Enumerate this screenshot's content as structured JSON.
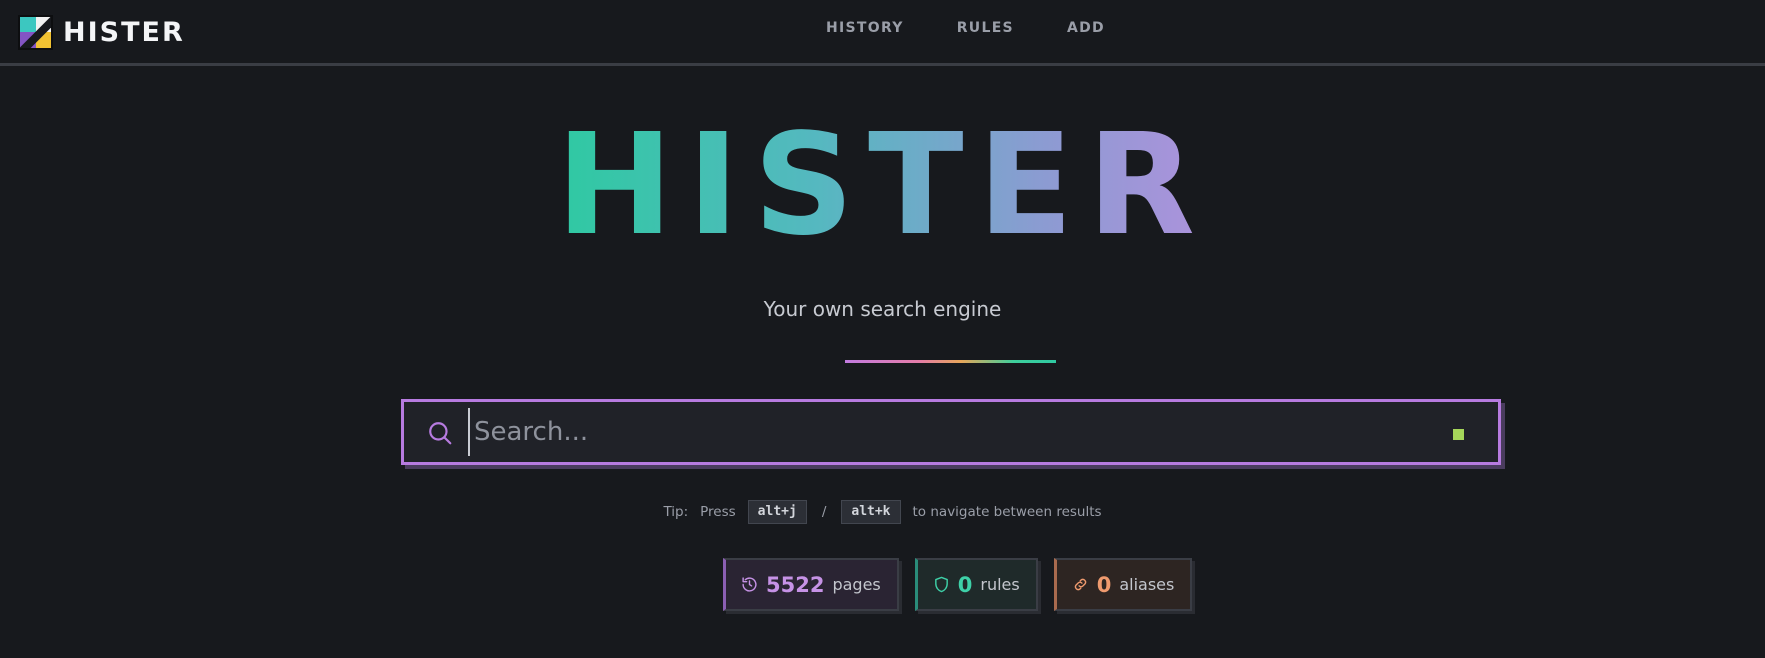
{
  "app": {
    "brand": "HISTER"
  },
  "nav": {
    "items": [
      "HISTORY",
      "RULES",
      "ADD"
    ]
  },
  "hero": {
    "title": "HISTER",
    "tagline": "Your own search engine"
  },
  "search": {
    "placeholder": "Search...",
    "value": ""
  },
  "tip": {
    "label": "Tip:",
    "press": "Press",
    "key_next": "alt+j",
    "separator": "/",
    "key_prev": "alt+k",
    "suffix": "to navigate between results"
  },
  "stats": [
    {
      "icon": "history-icon",
      "value": "5522",
      "label": "pages",
      "color": "#c692e6"
    },
    {
      "icon": "shield-icon",
      "value": "0",
      "label": "rules",
      "color": "#3ed1a8"
    },
    {
      "icon": "link-icon",
      "value": "0",
      "label": "aliases",
      "color": "#ee9a6e"
    }
  ],
  "colors": {
    "background": "#17191d",
    "accent": "#b77be0",
    "status_ok": "#a5d65a"
  }
}
